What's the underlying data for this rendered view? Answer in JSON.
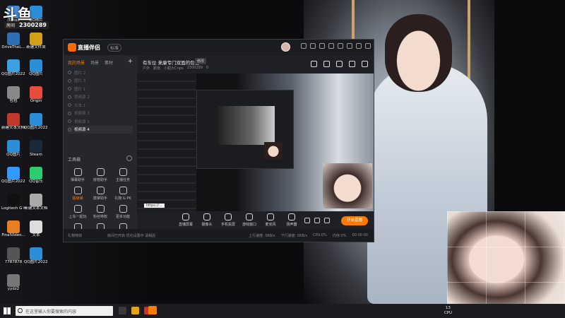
{
  "overlay": {
    "brand": "斗鱼",
    "room_id_label": "房间",
    "room_id": "2300289"
  },
  "desktop_icons": [
    {
      "label": "iTunes"
    },
    {
      "label": "DriveTheL..."
    },
    {
      "label": "QQ图片2022..."
    },
    {
      "label": "包包"
    },
    {
      "label": "新建文本文档(4)"
    },
    {
      "label": "QQ图片"
    },
    {
      "label": "QQ图片2022..."
    },
    {
      "label": "Logitech G HUB"
    },
    {
      "label": "FinalVideo..."
    },
    {
      "label": "7787878"
    },
    {
      "label": "yydz2"
    },
    {
      "label": "QQ图片"
    },
    {
      "label": "新建文件夹"
    },
    {
      "label": "QQ图片"
    },
    {
      "label": "Origin"
    },
    {
      "label": "QQ图片2022..."
    },
    {
      "label": "Steam"
    },
    {
      "label": "QQ音乐"
    },
    {
      "label": "新建文本文档"
    },
    {
      "label": "文本"
    },
    {
      "label": "QQ图片2022..."
    }
  ],
  "app": {
    "name": "直播伴侣",
    "version_badge": "标准",
    "left_tabs": [
      "我的场景",
      "场景",
      "素材"
    ],
    "scenes": [
      {
        "label": "图片 2"
      },
      {
        "label": "图片 3"
      },
      {
        "label": "图片 1"
      },
      {
        "label": "视频源 2"
      },
      {
        "label": "文本 1"
      },
      {
        "label": "视频源 3"
      },
      {
        "label": "视频源 1"
      },
      {
        "label": "视频源 4"
      }
    ],
    "tools_heading": "工具箱",
    "tools": [
      {
        "label": "弹幕助手",
        "hot": false
      },
      {
        "label": "房管助手",
        "hot": false
      },
      {
        "label": "主播任务",
        "hot": false
      },
      {
        "label": "超级弹",
        "hot": true
      },
      {
        "label": "鼓掌助手",
        "hot": false
      },
      {
        "label": "礼物 & PK",
        "hot": false
      },
      {
        "label": "上车一起玩",
        "hot": false
      },
      {
        "label": "粉丝特权",
        "hot": false
      },
      {
        "label": "更多功能",
        "hot": false
      },
      {
        "label": "",
        "hot": false
      },
      {
        "label": "",
        "hot": false
      },
      {
        "label": "",
        "hot": false
      }
    ],
    "room": {
      "title": "有车位 来康专门双面的包包",
      "edit_label": "修改",
      "meta": [
        "户外",
        "颜值",
        "小甜大Crips",
        "2300289",
        "0"
      ]
    },
    "preview_url_text": "https://...",
    "controls": [
      {
        "label": "直播屏幕"
      },
      {
        "label": "摄像头"
      },
      {
        "label": "手机投屏"
      },
      {
        "label": "游戏窗口"
      },
      {
        "label": "麦克风"
      },
      {
        "label": "扬声器"
      }
    ],
    "go_live_label": "开启直播",
    "status": {
      "left1": "礼物特效",
      "left2": "房间已开启 优化设置中 请稍后",
      "right": [
        "上行速度: 0KB/s",
        "下行速度: 0KB/s",
        "CPU:0%",
        "内存:0%",
        "00:00:00"
      ]
    }
  },
  "taskbar": {
    "search_placeholder": "在这里输入你要搜索的内容",
    "time": "13",
    "cpu": "CPU"
  }
}
